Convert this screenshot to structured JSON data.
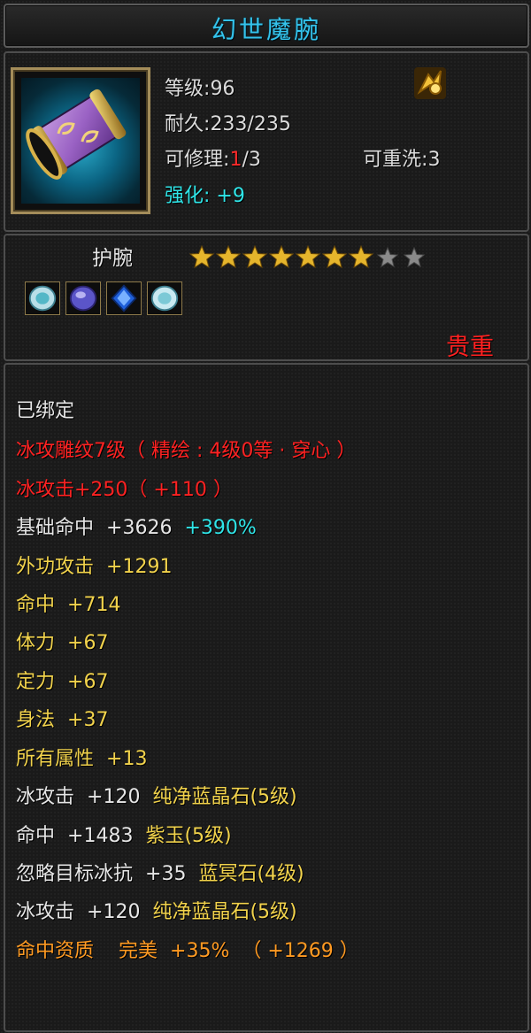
{
  "title": "幻世魔腕",
  "header": {
    "level_label": "等级",
    "level_value": "96",
    "durability_label": "耐久",
    "durability_value": "233/235",
    "repair_label": "可修理",
    "repair_current": "1",
    "repair_max": "/3",
    "rewash_label": "可重洗",
    "rewash_value": "3",
    "enhance_label": "强化",
    "enhance_value": "+9"
  },
  "item_type": "护腕",
  "stars": {
    "filled": 7,
    "total": 9
  },
  "gem_slots": [
    "ice-gem-icon",
    "purple-gem-icon",
    "blue-gem-icon",
    "ice-gem-icon"
  ],
  "rarity": "贵重",
  "attributes": {
    "bound": "已绑定",
    "engrave": "冰攻雕纹7级（ 精绘 : 4级0等 · 穿心 ）",
    "ice_attack": "冰攻击+250（ +110 ）",
    "base_hit_label": "基础命中",
    "base_hit_value": "+3626",
    "base_hit_bonus": "+390%",
    "outer_attack_label": "外功攻击",
    "outer_attack_value": "+1291",
    "hit_label": "命中",
    "hit_value": "+714",
    "stamina_label": "体力",
    "stamina_value": "+67",
    "focus_label": "定力",
    "focus_value": "+67",
    "agility_label": "身法",
    "agility_value": "+37",
    "all_attr_label": "所有属性",
    "all_attr_value": "+13",
    "gem1_stat": "冰攻击",
    "gem1_value": "+120",
    "gem1_name": "纯净蓝晶石",
    "gem1_level": "(5级)",
    "gem2_stat": "命中",
    "gem2_value": "+1483",
    "gem2_name": "紫玉",
    "gem2_level": "(5级)",
    "gem3_stat": "忽略目标冰抗",
    "gem3_value": "+35",
    "gem3_name": "蓝冥石",
    "gem3_level": "(4级)",
    "gem4_stat": "冰攻击",
    "gem4_value": "+120",
    "gem4_name": "纯净蓝晶石",
    "gem4_level": "(5级)",
    "quality_label": "命中资质",
    "quality_grade": "完美",
    "quality_value": "+35%",
    "quality_bonus": "（ +1269 ）"
  },
  "colors": {
    "title": "#34c3ec",
    "red": "#ff2222",
    "yellow": "#f2d34c",
    "cyan": "#2fe5e8",
    "orange": "#ff9a22",
    "star_filled": "#e5b52c",
    "star_empty": "#8a8a8a"
  }
}
